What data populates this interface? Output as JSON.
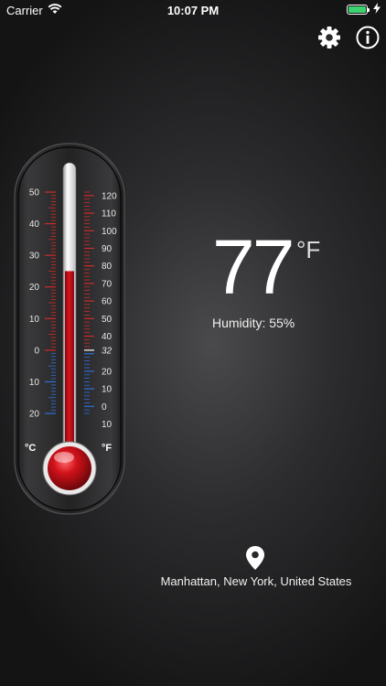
{
  "status_bar": {
    "carrier": "Carrier",
    "time": "10:07 PM"
  },
  "toolbar": {
    "settings_icon": "gear-icon",
    "info_icon": "info-icon"
  },
  "thermometer": {
    "celsius_unit": "°C",
    "fahrenheit_unit": "°F",
    "celsius_labels": [
      "50",
      "40",
      "30",
      "20",
      "10",
      "0",
      "10",
      "20"
    ],
    "fahrenheit_labels": [
      "120",
      "110",
      "100",
      "90",
      "80",
      "70",
      "60",
      "50",
      "40",
      "32",
      "20",
      "10",
      "0",
      "10"
    ],
    "temperature_f": 77,
    "colors": {
      "mercury": "#c8111a",
      "above_zero_ticks": "#d22a2a",
      "below_zero_ticks": "#2d6fd6"
    }
  },
  "reading": {
    "value": "77",
    "unit": "°F",
    "humidity": "Humidity: 55%"
  },
  "location": {
    "icon": "location-pin-icon",
    "text": "Manhattan, New York, United States"
  }
}
